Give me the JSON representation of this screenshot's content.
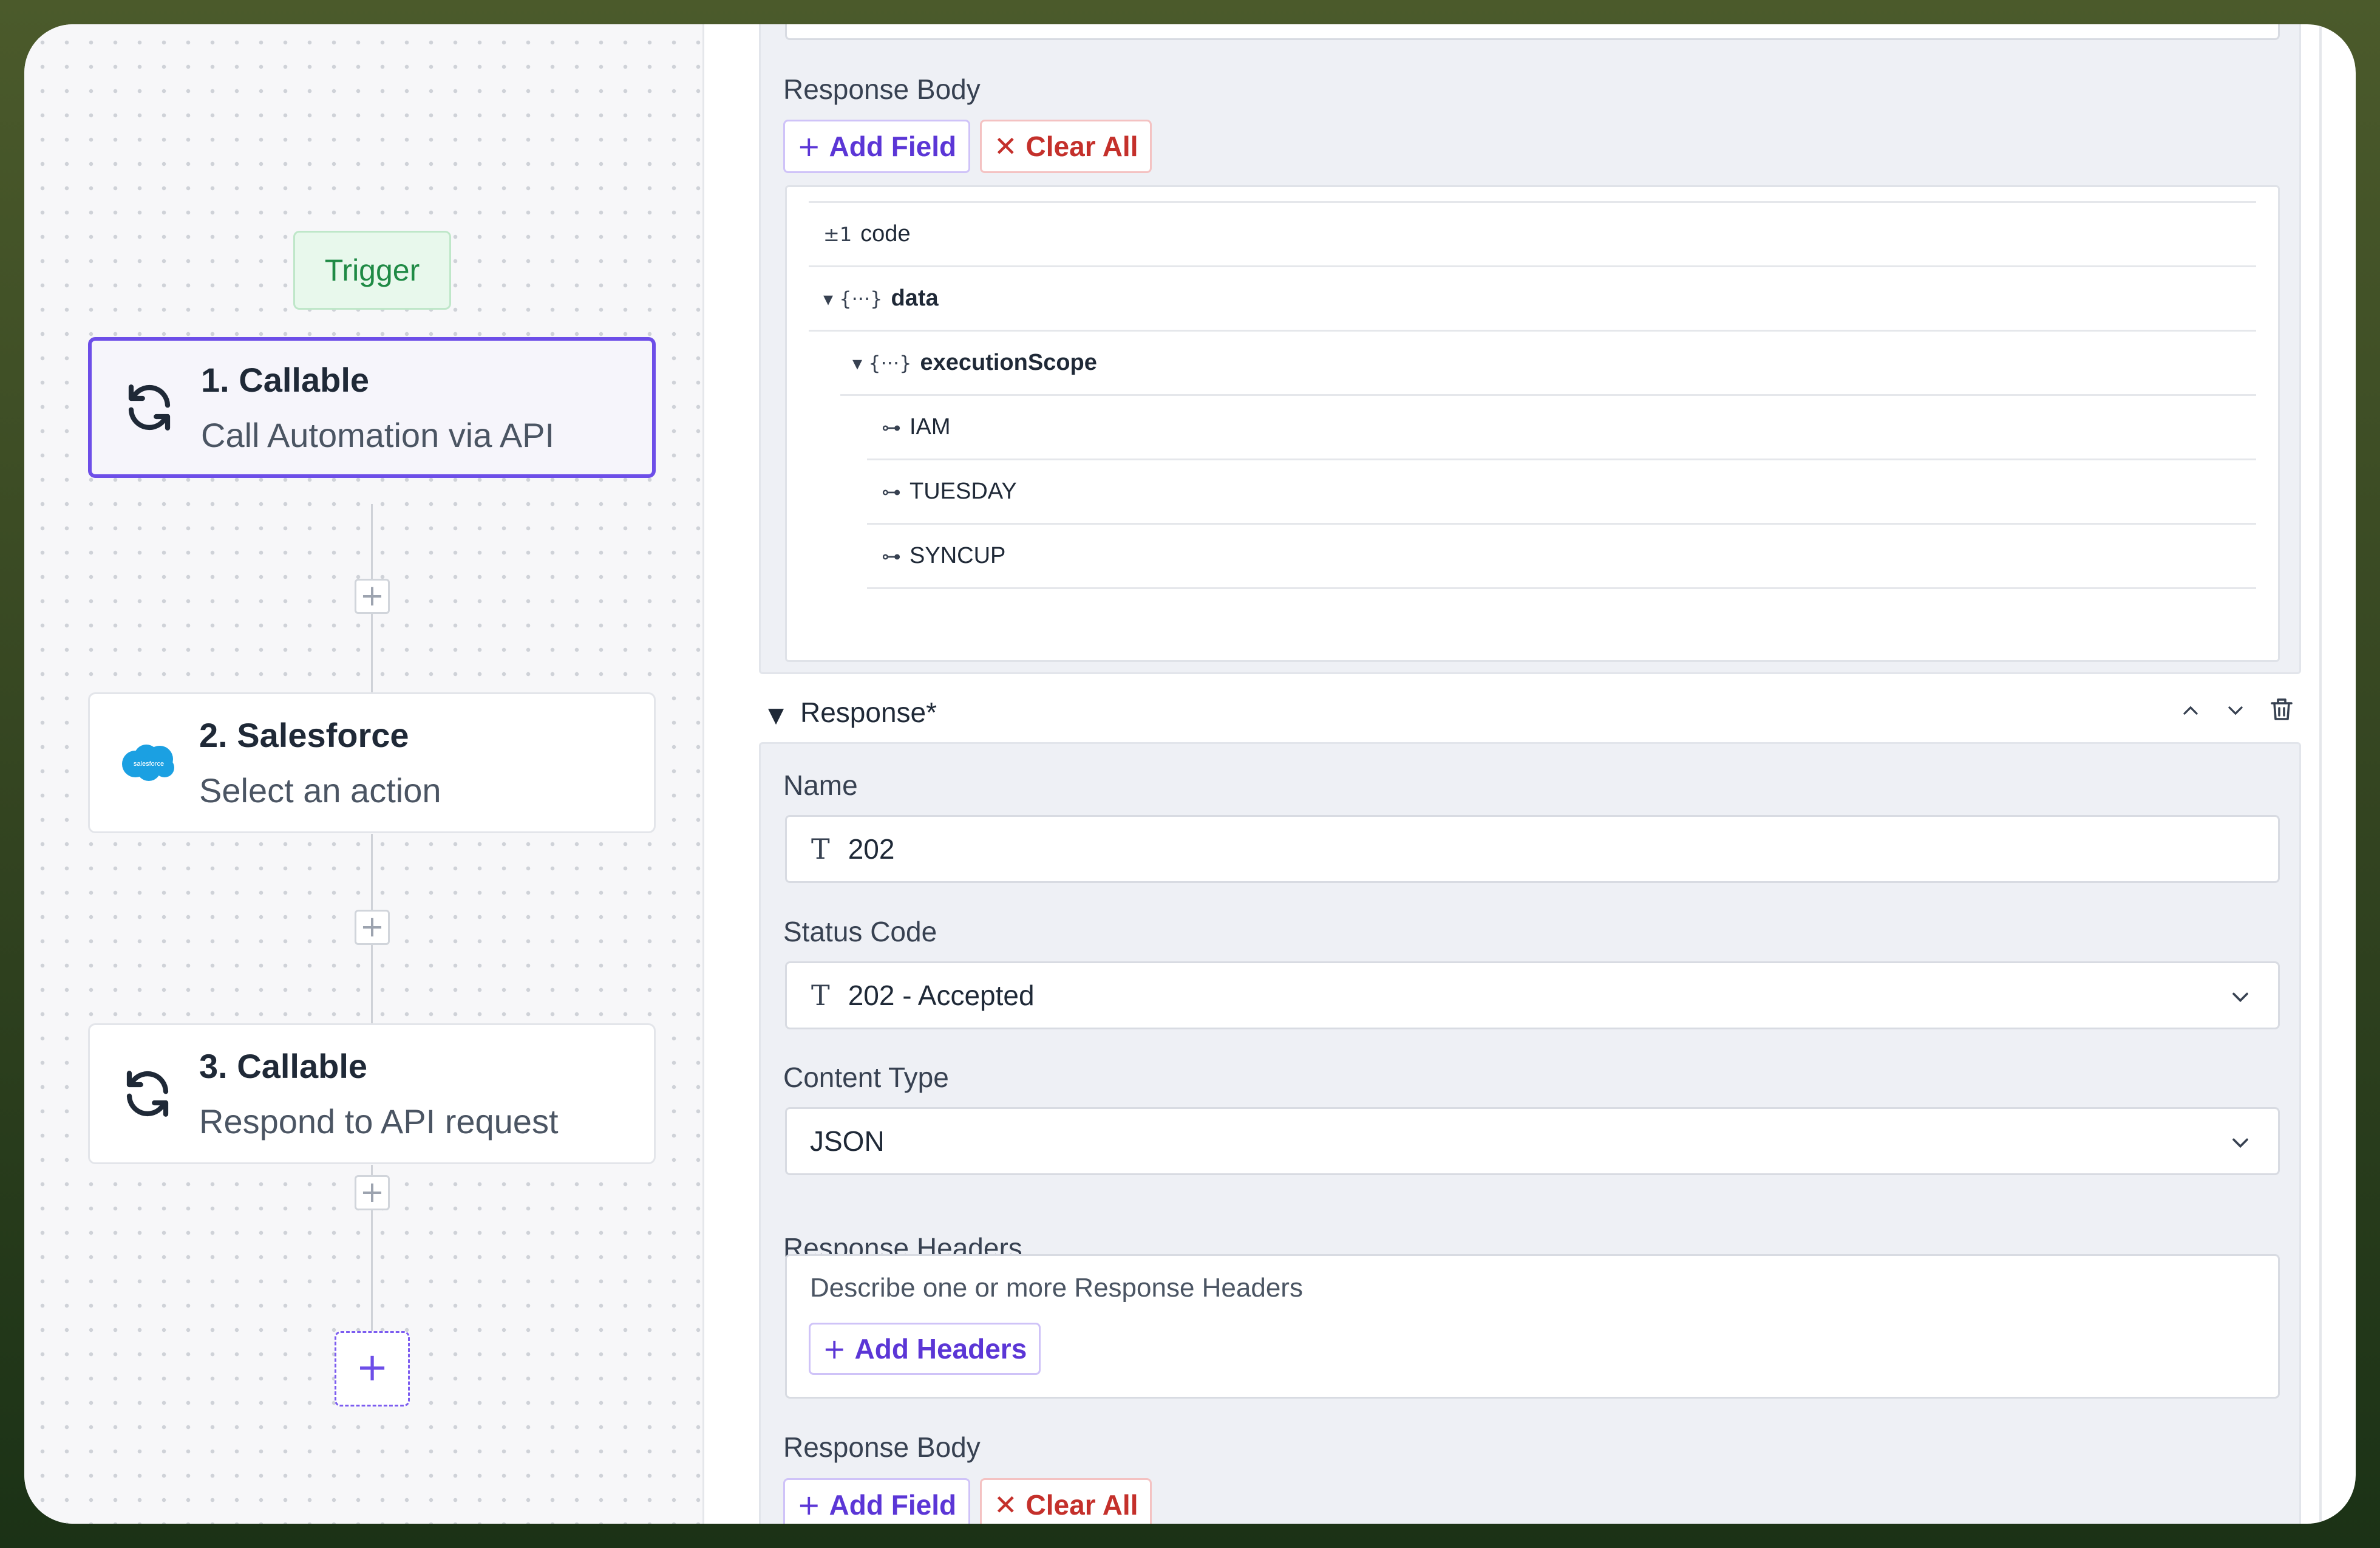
{
  "canvas": {
    "trigger_label": "Trigger",
    "nodes": [
      {
        "title": "1. Callable",
        "subtitle": "Call Automation via API",
        "icon": "refresh-icon"
      },
      {
        "title": "2. Salesforce",
        "subtitle": "Select an action",
        "icon": "salesforce-icon",
        "icon_text": "salesforce"
      },
      {
        "title": "3. Callable",
        "subtitle": "Respond to API request",
        "icon": "refresh-icon"
      }
    ],
    "add_step_glyph": "+"
  },
  "response_body_1": {
    "label": "Response Body",
    "add_field": "Add Field",
    "clear_all": "Clear All",
    "tree": [
      {
        "marker": "±1",
        "name": "code"
      },
      {
        "marker": "▾ {···}",
        "name": "data"
      },
      {
        "marker": "▾ {···}",
        "name": "executionScope"
      },
      {
        "marker": "⊶",
        "name": "IAM"
      },
      {
        "marker": "⊶",
        "name": "TUESDAY"
      },
      {
        "marker": "⊶",
        "name": "SYNCUP"
      }
    ]
  },
  "response": {
    "header": "Response*",
    "name_label": "Name",
    "name_value": "202",
    "status_label": "Status Code",
    "status_value": "202 - Accepted",
    "content_type_label": "Content Type",
    "content_type_value": "JSON",
    "headers_label": "Response Headers",
    "headers_placeholder": "Describe one or more Response Headers",
    "add_headers": "Add Headers",
    "body_label": "Response Body",
    "add_field": "Add Field",
    "clear_all": "Clear All"
  },
  "colors": {
    "accent": "#6d4ee8",
    "danger": "#c4302b",
    "trigger_green": "#1f8a45",
    "salesforce_blue": "#1ba0e2"
  }
}
